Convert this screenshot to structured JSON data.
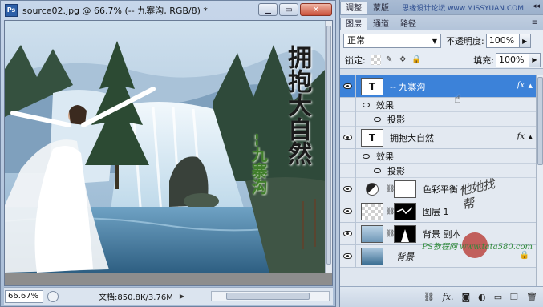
{
  "document": {
    "title": "source02.jpg @ 66.7% (-- 九寨沟, RGB/8) *",
    "zoom": "66.67%",
    "doc_size": "文档:850.8K/3.76M",
    "photo_text": {
      "headline": "拥抱大自然",
      "signature": "--九寨沟"
    }
  },
  "window_buttons": {
    "minimize": "▁",
    "restore": "▭",
    "close": "✕"
  },
  "panel_tabs": [
    "调整",
    "蒙版"
  ],
  "watermark": "思缘设计论坛 www.MISSYUAN.COM",
  "layer_tabs": [
    "图层",
    "通道",
    "路径"
  ],
  "blend_mode": "正常",
  "opacity_label": "不透明度:",
  "opacity_value": "100%",
  "lock_label": "锁定:",
  "fill_label": "填充:",
  "fill_value": "100%",
  "layers": [
    {
      "name": "-- 九寨沟",
      "type": "text",
      "selected": true,
      "fx": "fx",
      "effects_label": "效果",
      "effect": "投影"
    },
    {
      "name": "拥抱大自然",
      "type": "text",
      "selected": false,
      "fx": "fx",
      "effects_label": "效果",
      "effect": "投影"
    },
    {
      "name": "色彩平衡 1",
      "type": "adjustment",
      "selected": false
    },
    {
      "name": "图层 1",
      "type": "pixel",
      "selected": false
    },
    {
      "name": "背景 副本",
      "type": "pixel",
      "selected": false
    },
    {
      "name": "背景",
      "type": "background",
      "selected": false
    }
  ],
  "watermark_bottom": "PS教程网 www.tata580.com",
  "watermark_stamp": "他她找帮"
}
